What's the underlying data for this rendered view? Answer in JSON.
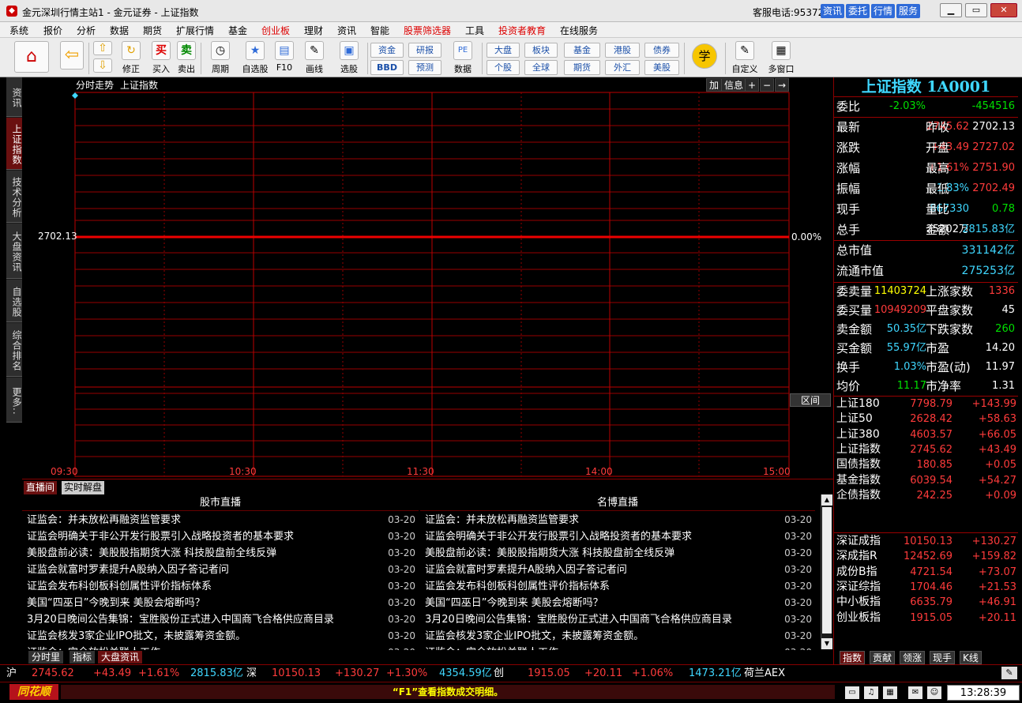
{
  "window": {
    "title": "金元深圳行情主站1 - 金元证券 - 上证指数",
    "hotline": "客服电话:95372",
    "title_buttons": [
      "资讯",
      "委托",
      "行情",
      "服务"
    ]
  },
  "menu": [
    "系统",
    "报价",
    "分析",
    "数据",
    "期货",
    "扩展行情",
    "基金",
    "创业板",
    "理财",
    "资讯",
    "智能",
    "股票筛选器",
    "工具",
    "投资者教育",
    "在线服务"
  ],
  "toolbar": {
    "buy": "买",
    "buy_label": "买入",
    "sell": "卖",
    "sell_label": "卖出",
    "xiuzheng": "修正",
    "zhouqi": "周期",
    "zixuan": "自选股",
    "f10": "F10",
    "huaxian": "画线",
    "xuangu": "选股",
    "zijin": "资金",
    "bbd": "BBD",
    "yanbao": "研报",
    "yuce": "预测",
    "pe": "PE",
    "shuju": "数据",
    "dapan": "大盘",
    "gegu": "个股",
    "bankuai": "板块",
    "quanqiu": "全球",
    "jijin": "基金",
    "qihuo": "期货",
    "ganggu": "港股",
    "waihui": "外汇",
    "zhaiquan": "债券",
    "meigu": "美股",
    "xue": "学",
    "zidingyi": "自定义",
    "duochuangkou": "多窗口"
  },
  "left_tabs": [
    "资讯",
    "上证指数",
    "技术分析",
    "大盘资讯",
    "自选股",
    "综合排名",
    "更多.."
  ],
  "chart": {
    "header_label": "分时走势",
    "header_name": "上证指数",
    "buttons": [
      "加",
      "信息",
      "+",
      "−",
      "→"
    ],
    "base_price": "2702.13",
    "base_pct": "0.00%",
    "time_labels": [
      "09:30",
      "10:30",
      "11:30",
      "14:00",
      "15:00"
    ],
    "qujian": "区间"
  },
  "news": {
    "tabs": [
      "直播间",
      "实时解盘"
    ],
    "left_title": "股市直播",
    "right_title": "名博直播",
    "items": [
      {
        "text": "证监会：并未放松再融资监管要求",
        "date": "03-20"
      },
      {
        "text": "证监会明确关于非公开发行股票引入战略投资者的基本要求",
        "date": "03-20"
      },
      {
        "text": "美股盘前必读：美股股指期货大涨 科技股盘前全线反弹",
        "date": "03-20"
      },
      {
        "text": "证监会就富时罗素提升A股纳入因子答记者问",
        "date": "03-20"
      },
      {
        "text": "证监会发布科创板科创属性评价指标体系",
        "date": "03-20"
      },
      {
        "text": "美国“四巫日”今晚到来 美股会熔断吗？",
        "date": "03-20"
      },
      {
        "text": "3月20日晚间公告集锦：宝胜股份正式进入中国商飞合格供应商目录",
        "date": "03-20"
      },
      {
        "text": "证监会核发3家企业IPO批文，未披露筹资金额。",
        "date": "03-20"
      },
      {
        "text": "证监会：完全放松关联人工作",
        "date": "03-20"
      }
    ]
  },
  "bottom_tabs": [
    "分时里",
    "指标",
    "大盘资讯"
  ],
  "quote": {
    "title": "上证指数 1A0001",
    "weibi_label": "委比",
    "weibi_pct": "-2.03%",
    "weibi_val": "-454516",
    "rows": [
      {
        "l1": "最新",
        "v1": "2745.62",
        "c1": "red",
        "l2": "昨收",
        "v2": "2702.13",
        "c2": "white"
      },
      {
        "l1": "涨跌",
        "v1": "+43.49",
        "c1": "red",
        "l2": "开盘",
        "v2": "2727.02",
        "c2": "red"
      },
      {
        "l1": "涨幅",
        "v1": "+1.61%",
        "c1": "red",
        "l2": "最高",
        "v2": "2751.90",
        "c2": "red"
      },
      {
        "l1": "振幅",
        "v1": "1.83%",
        "c1": "cyan",
        "l2": "最低",
        "v2": "2702.49",
        "c2": "red"
      },
      {
        "l1": "现手",
        "v1": "867330",
        "c1": "cyan",
        "l2": "量比",
        "v2": "0.78",
        "c2": "green"
      },
      {
        "l1": "总手",
        "v1": "25202万",
        "c1": "white",
        "l2": "金额",
        "v2": "2815.83亿",
        "c2": "cyan"
      }
    ],
    "zongshizhi_label": "总市值",
    "zongshizhi": "331142亿",
    "liutong_label": "流通市值",
    "liutong": "275253亿",
    "rows2": [
      {
        "l1": "委卖量",
        "v1": "11403724",
        "c1": "yellow",
        "l2": "上涨家数",
        "v2": "1336",
        "c2": "red"
      },
      {
        "l1": "委买量",
        "v1": "10949209",
        "c1": "red",
        "l2": "平盘家数",
        "v2": "45",
        "c2": "white"
      },
      {
        "l1": "卖金额",
        "v1": "50.35亿",
        "c1": "cyan",
        "l2": "下跌家数",
        "v2": "260",
        "c2": "green"
      },
      {
        "l1": "买金额",
        "v1": "55.97亿",
        "c1": "cyan",
        "l2": "市盈",
        "v2": "14.20",
        "c2": "white"
      },
      {
        "l1": "换手",
        "v1": "1.03%",
        "c1": "cyan",
        "l2": "市盈(动)",
        "v2": "11.97",
        "c2": "white"
      },
      {
        "l1": "均价",
        "v1": "11.17",
        "c1": "green",
        "l2": "市净率",
        "v2": "1.31",
        "c2": "white"
      }
    ],
    "indices1": [
      {
        "n": "上证180",
        "p": "7798.79",
        "c": "+143.99"
      },
      {
        "n": "上证50",
        "p": "2628.42",
        "c": "+58.63"
      },
      {
        "n": "上证380",
        "p": "4603.57",
        "c": "+66.05"
      },
      {
        "n": "上证指数",
        "p": "2745.62",
        "c": "+43.49"
      },
      {
        "n": "国债指数",
        "p": "180.85",
        "c": "+0.05"
      },
      {
        "n": "基金指数",
        "p": "6039.54",
        "c": "+54.27"
      },
      {
        "n": "企债指数",
        "p": "242.25",
        "c": "+0.09"
      }
    ],
    "indices2": [
      {
        "n": "深证成指",
        "p": "10150.13",
        "c": "+130.27"
      },
      {
        "n": "深成指R",
        "p": "12452.69",
        "c": "+159.82"
      },
      {
        "n": "成份B指",
        "p": "4721.54",
        "c": "+73.07"
      },
      {
        "n": "深证综指",
        "p": "1704.46",
        "c": "+21.53"
      },
      {
        "n": "中小板指",
        "p": "6635.79",
        "c": "+46.91"
      },
      {
        "n": "创业板指",
        "p": "1915.05",
        "c": "+20.11"
      }
    ],
    "tabs": [
      "指数",
      "贡献",
      "领涨",
      "现手",
      "K线"
    ]
  },
  "ticker": {
    "sh_label": "沪",
    "sh_price": "2745.62",
    "sh_chg": "+43.49",
    "sh_pct": "+1.61%",
    "sh_amt": "2815.83亿",
    "sz_label": "深",
    "sz_price": "10150.13",
    "sz_chg": "+130.27",
    "sz_pct": "+1.30%",
    "sz_amt": "4354.59亿",
    "cy_label": "创",
    "cy_price": "1915.05",
    "cy_chg": "+20.11",
    "cy_pct": "+1.06%",
    "cy_amt": "1473.21亿",
    "other": "荷兰AEX"
  },
  "status": {
    "brand": "同花顺",
    "message": "“F1”查看指数成交明细。",
    "time": "13:28:39"
  }
}
